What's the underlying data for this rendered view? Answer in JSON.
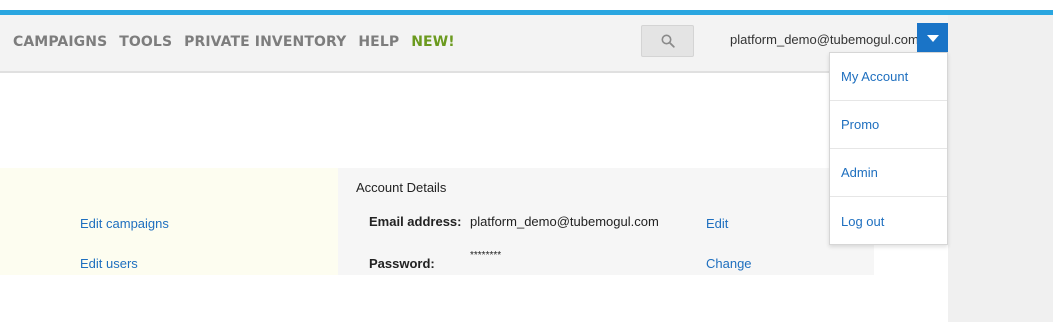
{
  "nav": {
    "items": [
      "CAMPAIGNS",
      "TOOLS",
      "PRIVATE INVENTORY",
      "HELP"
    ],
    "new_label": "NEW!"
  },
  "search": {
    "icon": "magnifier"
  },
  "user": {
    "email": "platform_demo@tubemogul.com"
  },
  "account_menu": {
    "items": [
      "My Account",
      "Promo",
      "Admin",
      "Log out"
    ]
  },
  "sidebar_links": [
    "Edit campaigns",
    "Edit users"
  ],
  "account_details": {
    "title": "Account Details",
    "email_label": "Email address:",
    "email_value": "platform_demo@tubemogul.com",
    "email_action": "Edit",
    "password_label": "Password:",
    "password_value": "********",
    "password_action": "Change"
  },
  "colors": {
    "accent": "#2aa6e0",
    "dropdown": "#1a74c7",
    "link": "#1e6fbf",
    "new": "#6b9a1e"
  }
}
